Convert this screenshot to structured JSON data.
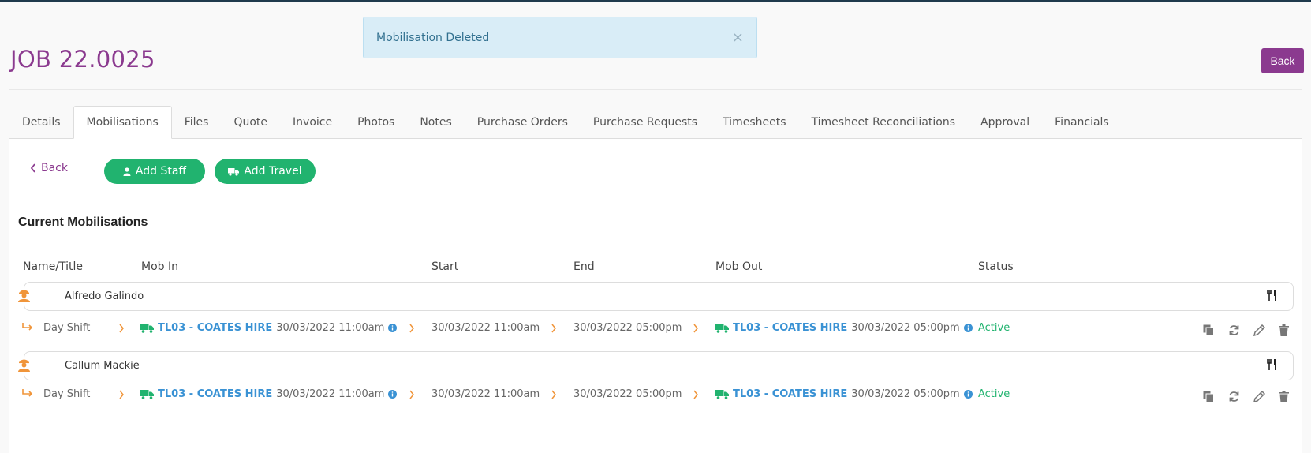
{
  "alert": {
    "message": "Mobilisation Deleted",
    "close_glyph": "×"
  },
  "page": {
    "title": "JOB 22.0025",
    "back_label": "Back"
  },
  "tabs": [
    {
      "label": "Details"
    },
    {
      "label": "Mobilisations"
    },
    {
      "label": "Files"
    },
    {
      "label": "Quote"
    },
    {
      "label": "Invoice"
    },
    {
      "label": "Photos"
    },
    {
      "label": "Notes"
    },
    {
      "label": "Purchase Orders"
    },
    {
      "label": "Purchase Requests"
    },
    {
      "label": "Timesheets"
    },
    {
      "label": "Timesheet Reconciliations"
    },
    {
      "label": "Approval"
    },
    {
      "label": "Financials"
    }
  ],
  "toolbar": {
    "back_label": "Back",
    "add_staff_label": "Add Staff",
    "add_travel_label": "Add Travel"
  },
  "section": {
    "title": "Current Mobilisations"
  },
  "columns": {
    "name": "Name/Title",
    "mob_in": "Mob In",
    "start": "Start",
    "end": "End",
    "mob_out": "Mob Out",
    "status": "Status"
  },
  "mobilisations": [
    {
      "person": "Alfredo Galindo",
      "shift": "Day Shift",
      "mob_in_vehicle": "TL03 - COATES HIRE",
      "mob_in_time": "30/03/2022 11:00am",
      "start": "30/03/2022 11:00am",
      "end": "30/03/2022 05:00pm",
      "mob_out_vehicle": "TL03 - COATES HIRE",
      "mob_out_time": "30/03/2022 05:00pm",
      "status": "Active"
    },
    {
      "person": "Callum Mackie",
      "shift": "Day Shift",
      "mob_in_vehicle": "TL03 - COATES HIRE",
      "mob_in_time": "30/03/2022 11:00am",
      "start": "30/03/2022 11:00am",
      "end": "30/03/2022 05:00pm",
      "mob_out_vehicle": "TL03 - COATES HIRE",
      "mob_out_time": "30/03/2022 05:00pm",
      "status": "Active"
    }
  ],
  "colors": {
    "brand": "#8b3a8f",
    "green": "#21b36f",
    "link": "#3a92d4",
    "orange": "#f0953a",
    "alert_bg": "#d9edf7"
  }
}
